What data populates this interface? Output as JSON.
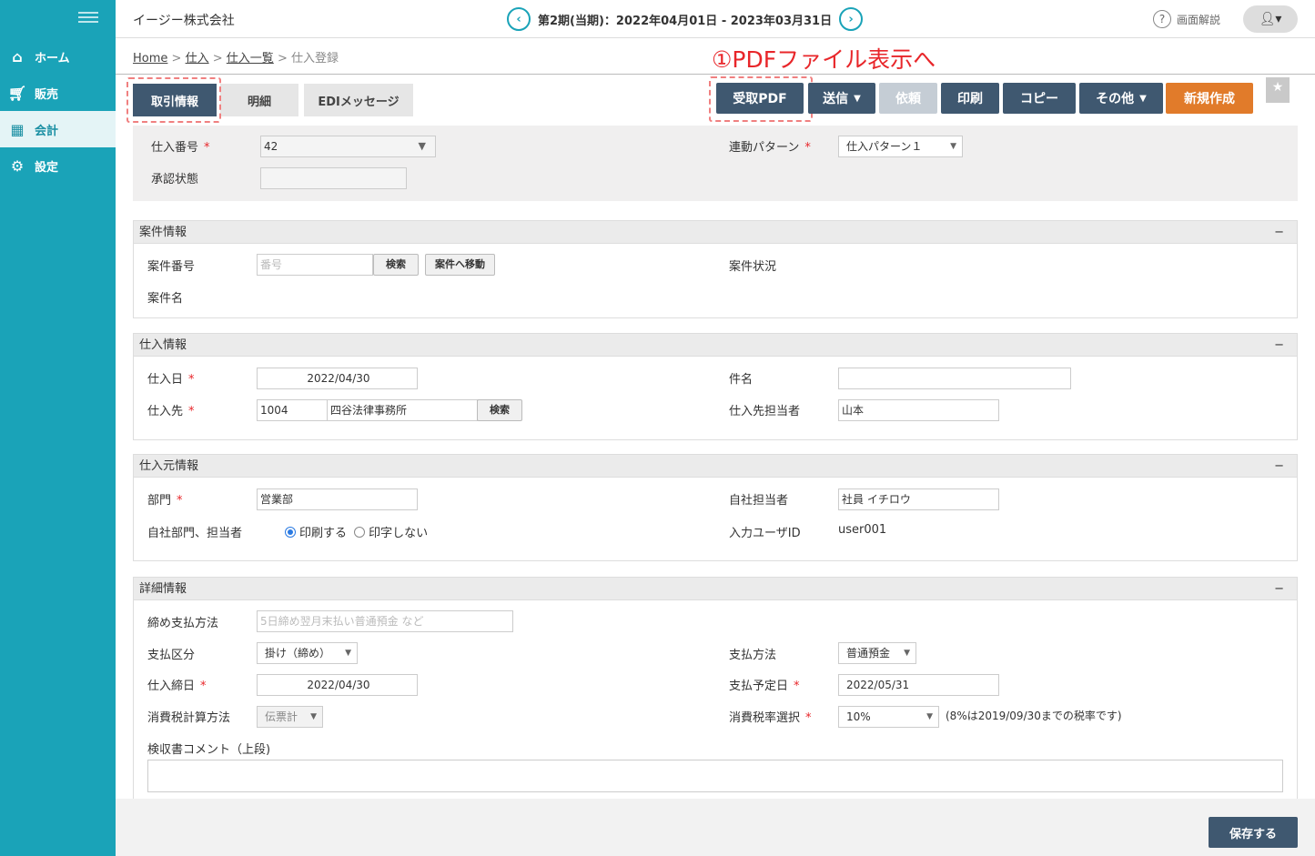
{
  "sidebar": {
    "items": [
      {
        "label": "ホーム",
        "icon": "home-icon"
      },
      {
        "label": "販売",
        "icon": "cart-icon"
      },
      {
        "label": "会計",
        "icon": "calculator-icon"
      },
      {
        "label": "設定",
        "icon": "gear-icon"
      }
    ]
  },
  "header": {
    "company": "イージー株式会社",
    "period": "第2期(当期)：2022年04月01日 - 2023年03月31日",
    "help_label": "画面解説"
  },
  "breadcrumb": {
    "home": "Home",
    "purchase": "仕入",
    "list": "仕入一覧",
    "current": "仕入登録",
    "sep": ">"
  },
  "annotation": "①PDFファイル表示へ",
  "tabs": [
    "取引情報",
    "明細",
    "EDIメッセージ"
  ],
  "toolbar": {
    "receive_pdf": "受取PDF",
    "send": "送信",
    "request": "依頼",
    "print": "印刷",
    "copy": "コピー",
    "other": "その他",
    "new": "新規作成"
  },
  "top_form": {
    "purchase_no_label": "仕入番号",
    "purchase_no": "42",
    "approval_label": "承認状態",
    "pattern_label": "連動パターン",
    "pattern_value": "仕入パターン１"
  },
  "project": {
    "title": "案件情報",
    "no_label": "案件番号",
    "no_placeholder": "番号",
    "search": "検索",
    "move": "案件へ移動",
    "status_label": "案件状況",
    "name_label": "案件名"
  },
  "purchase": {
    "title": "仕入情報",
    "date_label": "仕入日",
    "date": "2022/04/30",
    "vendor_label": "仕入先",
    "vendor_code": "1004",
    "vendor_name": "四谷法律事務所",
    "search": "検索",
    "subject_label": "件名",
    "vendor_staff_label": "仕入先担当者",
    "vendor_staff": "山本"
  },
  "source": {
    "title": "仕入元情報",
    "dept_label": "部門",
    "dept": "営業部",
    "print_label": "自社部門、担当者",
    "print_on": "印刷する",
    "print_off": "印字しない",
    "staff_label": "自社担当者",
    "staff": "社員 イチロウ",
    "user_label": "入力ユーザID",
    "user": "user001"
  },
  "detail": {
    "title": "詳細情報",
    "closing_label": "締め支払方法",
    "closing_placeholder": "5日締め翌月末払い普通預金 など",
    "pay_type_label": "支払区分",
    "pay_type": "掛け（締め）",
    "pay_method_label": "支払方法",
    "pay_method": "普通預金",
    "close_date_label": "仕入締日",
    "close_date": "2022/04/30",
    "due_label": "支払予定日",
    "due": "2022/05/31",
    "tax_calc_label": "消費税計算方法",
    "tax_calc": "伝票計",
    "tax_rate_label": "消費税率選択",
    "tax_rate": "10%",
    "tax_note": "(8%は2019/09/30までの税率です)",
    "comment_label": "検収書コメント（上段)"
  },
  "footer": {
    "save": "保存する"
  },
  "colors": {
    "sidebar": "#1aa3b8",
    "button": "#3f5870",
    "new_button": "#e17b2a",
    "annotation": "#e8262a"
  }
}
